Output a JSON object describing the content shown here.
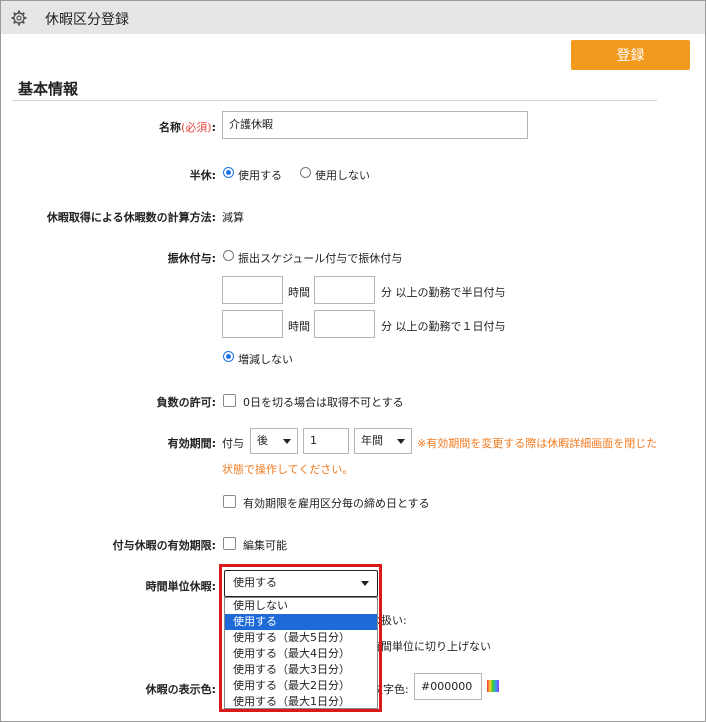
{
  "window": {
    "title": "休暇区分登録"
  },
  "toolbar": {
    "save_label": "登録"
  },
  "section": {
    "title": "基本情報"
  },
  "name_row": {
    "label": "名称",
    "required": "(必須)",
    "colon": ":",
    "value": "介護休暇"
  },
  "half_day": {
    "label": "半休:",
    "opt_use": "使用する",
    "opt_nouse": "使用しない",
    "selected": "使用する"
  },
  "calc": {
    "label": "休暇取得による休暇数の計算方法:",
    "value": "減算"
  },
  "substitute": {
    "label": "振休付与:",
    "opt_schedule": "振出スケジュール付与で振休付与",
    "hour_unit": "時間",
    "min_half": "分 以上の勤務で半日付与",
    "min_full": "分 以上の勤務で１日付与",
    "opt_none": "増減しない",
    "selected": "増減しない"
  },
  "negative": {
    "label": "負数の許可:",
    "check_text": "0日を切る場合は取得不可とする"
  },
  "validity": {
    "label": "有効期間:",
    "prefix": "付与",
    "select1": "後",
    "number": "1",
    "select2": "年間",
    "note_line1": "※有効期間を変更する際は休暇詳細画面を閉じた",
    "note_line2": "状態で操作してください。",
    "check_text": "有効期限を雇用区分毎の締め日とする"
  },
  "grant_validity": {
    "label": "付与休暇の有効期限:",
    "check_text": "編集可能"
  },
  "hourly": {
    "label": "時間単位休暇:",
    "selected": "使用する",
    "options": [
      "使用しない",
      "使用する",
      "使用する（最大5日分）",
      "使用する（最大4日分）",
      "使用する（最大3日分）",
      "使用する（最大2日分）",
      "使用する（最大1日分）"
    ],
    "behind_text1": "の扱い:",
    "behind_text2": "時間単位に切り上げない"
  },
  "display_color": {
    "label": "休暇の表示色:",
    "text_color_label": "文字色:",
    "text_color_value": "#000000"
  },
  "colors": {
    "accent": "#f39a1e",
    "highlight": "#d81a1a",
    "note": "#f07a1f",
    "selected_option": "#1e6ad8"
  }
}
